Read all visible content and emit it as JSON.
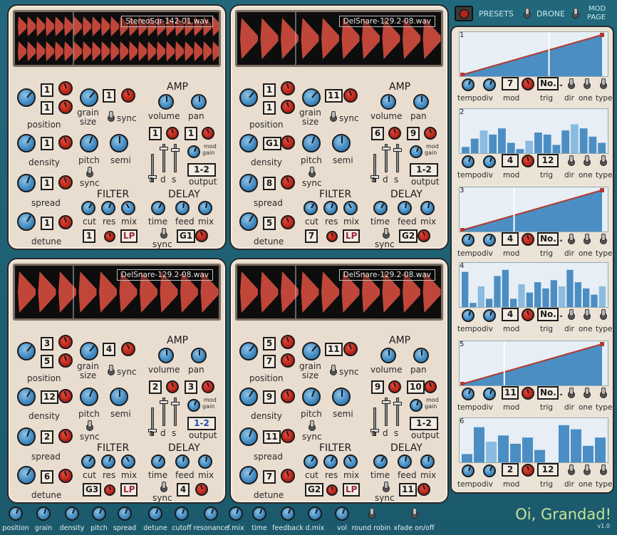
{
  "samplers": [
    {
      "filename": "StereoSqr-142-01.wav",
      "pos1": "1",
      "pos2": "1",
      "grain": "1",
      "density": "1",
      "spread": "1",
      "detune": "1",
      "vol": "1",
      "pan": "1",
      "mod_src": "1-2",
      "filter_a": "1",
      "filter_type": "LP",
      "delay_box": "G1",
      "wave": "dense"
    },
    {
      "filename": "DelSnare-129.2-08.wav",
      "pos1": "1",
      "pos2": "1",
      "grain": "11",
      "density": "G1",
      "spread": "8",
      "detune": "5",
      "vol": "6",
      "pan": "9",
      "mod_src": "1-2",
      "filter_a": "7",
      "filter_type": "LP",
      "delay_box": "G2",
      "wave": "snare"
    },
    {
      "filename": "DelSnare-129.2-08.wav",
      "pos1": "3",
      "pos2": "5",
      "grain": "4",
      "density": "12",
      "spread": "2",
      "detune": "6",
      "vol": "2",
      "pan": "3",
      "mod_src": "1-2",
      "filter_a": "G3",
      "filter_type": "LP",
      "delay_box": "4",
      "wave": "snare"
    },
    {
      "filename": "DelSnare-129.2-08.wav",
      "pos1": "5",
      "pos2": "7",
      "grain": "11",
      "density": "9",
      "spread": "11",
      "detune": "7",
      "vol": "9",
      "pan": "10",
      "mod_src": "1-2",
      "filter_a": "G2",
      "filter_type": "LP",
      "delay_box": "11",
      "wave": "snare"
    }
  ],
  "labels": {
    "position": "position",
    "grain": "grain",
    "size": "size",
    "sync": "sync",
    "density": "density",
    "pitch": "pitch",
    "semi": "semi",
    "spread": "spread",
    "detune": "detune",
    "amp": "AMP",
    "volume": "volume",
    "pan": "pan",
    "mod": "mod",
    "gain": "gain",
    "a": "a",
    "d": "d",
    "s": "s",
    "output": "output",
    "filter": "FILTER",
    "delay": "DELAY",
    "cut": "cut",
    "res": "res",
    "mix": "mix",
    "time": "time",
    "feed": "feed"
  },
  "top": {
    "presets": "PRESETS",
    "drone": "DRONE",
    "mod": "MOD",
    "page": "PAGE"
  },
  "mod_lanes": [
    {
      "num": "1",
      "type": "ramp",
      "mod_value": "7",
      "trig": "No...",
      "marker": 0.62
    },
    {
      "num": "2",
      "type": "bars",
      "mod_value": "4",
      "trig": "12",
      "values": [
        0.15,
        0.35,
        0.55,
        0.45,
        0.6,
        0.25,
        0.1,
        0.3,
        0.5,
        0.45,
        0.2,
        0.55,
        0.7,
        0.6,
        0.4,
        0.25
      ]
    },
    {
      "num": "3",
      "type": "ramp",
      "mod_value": "4",
      "trig": "No...",
      "marker": 0.37
    },
    {
      "num": "4",
      "type": "bars",
      "mod_value": "4",
      "trig": "No...",
      "values": [
        0.85,
        0.1,
        0.5,
        0.2,
        0.75,
        0.9,
        0.2,
        0.55,
        0.35,
        0.6,
        0.45,
        0.65,
        0.5,
        0.9,
        0.6,
        0.45,
        0.3,
        0.5
      ]
    },
    {
      "num": "5",
      "type": "ramp",
      "mod_value": "11",
      "trig": "No...",
      "marker": 0.3
    },
    {
      "num": "6",
      "type": "bars",
      "mod_value": "2",
      "trig": "12",
      "values": [
        0.2,
        0.85,
        0.5,
        0.65,
        0.45,
        0.6,
        0.3,
        0.0,
        0.9,
        0.8,
        0.4,
        0.6
      ]
    }
  ],
  "lane_labels": {
    "tempo": "tempo",
    "div": "div",
    "mod": "mod",
    "trig": "trig",
    "dir": "dir",
    "one": "one",
    "type": "type"
  },
  "bottom": [
    "position",
    "grain",
    "density",
    "pitch",
    "spread",
    "detune",
    "cutoff",
    "resonance",
    "f.mix",
    "time",
    "feedback",
    "d.mix",
    "vol",
    "round robin",
    "xfade on/off"
  ],
  "brand": "Oi, Grandad!",
  "version": "v1.0"
}
